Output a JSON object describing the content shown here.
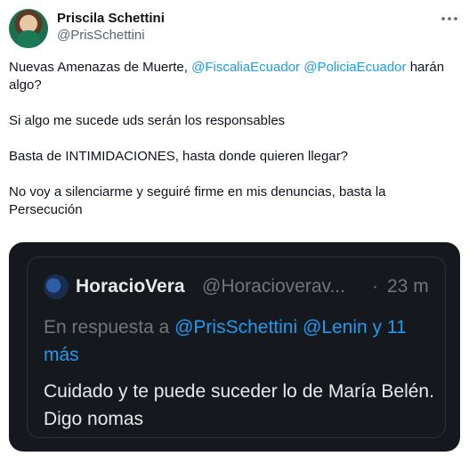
{
  "tweet": {
    "author_name": "Priscila Schettini",
    "author_handle": "@PrisSchettini",
    "more_icon": "ellipsis-icon",
    "paragraphs": {
      "p1_pre": "Nuevas Amenazas de Muerte, ",
      "p1_mention1": "@FiscaliaEcuador",
      "p1_space": " ",
      "p1_mention2": "@PoliciaEcuador",
      "p1_post": " harán algo?",
      "p2": "Si algo me sucede uds serán los responsables",
      "p3": "Basta de INTIMIDACIONES, hasta donde quieren llegar?",
      "p4": "No voy a silenciarme y seguiré firme en mis denuncias, basta la Persecución"
    }
  },
  "quoted": {
    "author_name": "HoracioVera",
    "author_handle": "@Horacioverav...",
    "separator": "·",
    "time": "23 m",
    "reply_prefix": "En respuesta a ",
    "reply_mention1": "@PrisSchettini",
    "reply_space": " ",
    "reply_mention2": "@Lenin",
    "reply_suffix": " y 11 más",
    "text": "Cuidado y te puede suceder lo de María Belén. Digo nomas"
  },
  "colors": {
    "accent": "#1d9bf0",
    "embed_bg": "#15181c",
    "muted": "#536471"
  }
}
